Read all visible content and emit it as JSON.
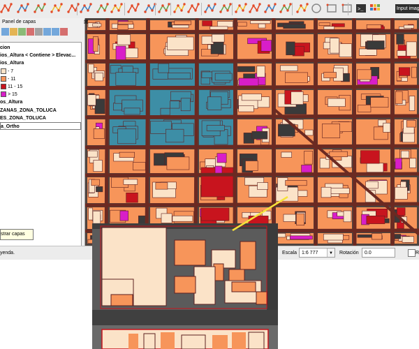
{
  "colors": {
    "building_orange": "#f7955a",
    "building_cream": "#fbe3c8",
    "building_red": "#c8141e",
    "building_magenta": "#d81ec8",
    "building_teal": "#3d8ea6",
    "road": "#6b2a22",
    "leader_line": "#f5e23a"
  },
  "toolbar": {
    "icons": [
      "node-tool-icon",
      "add-vertex-icon",
      "delete-vertex-icon",
      "move-feature-icon",
      "add-ring-icon",
      "add-part-icon",
      "fill-ring-icon",
      "delete-ring-icon",
      "delete-part-icon",
      "reshape-icon",
      "offset-curve-icon",
      "split-features-icon",
      "split-parts-icon",
      "merge-features-icon",
      "merge-attributes-icon",
      "rotate-point-icon",
      "simplify-icon",
      "rotate-feature-icon",
      "reverse-line-icon",
      "trace-icon",
      "circle-icon",
      "rectangle-icon",
      "regular-polygon-icon",
      "python-console-icon",
      "raster-icon"
    ],
    "input_image_label": "Input imag"
  },
  "layers_panel": {
    "title": "Panel de capas",
    "tools": [
      "open-layer-styling-icon",
      "add-group-icon",
      "manage-themes-icon",
      "filter-legend-icon",
      "filter-expression-icon",
      "expand-all-icon",
      "collapse-all-icon",
      "remove-layer-icon"
    ],
    "layers": [
      {
        "text": "cion",
        "bold": true
      },
      {
        "text": "ios_Altura < Contiene > Elevac...",
        "bold": true
      },
      {
        "text": "ios_Altura",
        "bold": true
      },
      {
        "text": "- 7",
        "bold": false
      },
      {
        "text": "- 11",
        "bold": false
      },
      {
        "text": "11 - 15",
        "bold": false
      },
      {
        "text": "> 15",
        "bold": false
      },
      {
        "text": "os_Altura",
        "bold": true
      },
      {
        "text": "ZANAS_ZONA_TOLUCA",
        "bold": true
      },
      {
        "text": "ES_ZONA_TOLUCA",
        "bold": true
      },
      {
        "text": "a_Ortho",
        "bold": true
      }
    ],
    "tooltip": "strar capas"
  },
  "statusbar": {
    "message": "yenda.",
    "scale_label": "Escala",
    "scale_value": "1:6 777",
    "rotation_label": "Rotación",
    "rotation_value": "0.0",
    "render_label": "R"
  }
}
